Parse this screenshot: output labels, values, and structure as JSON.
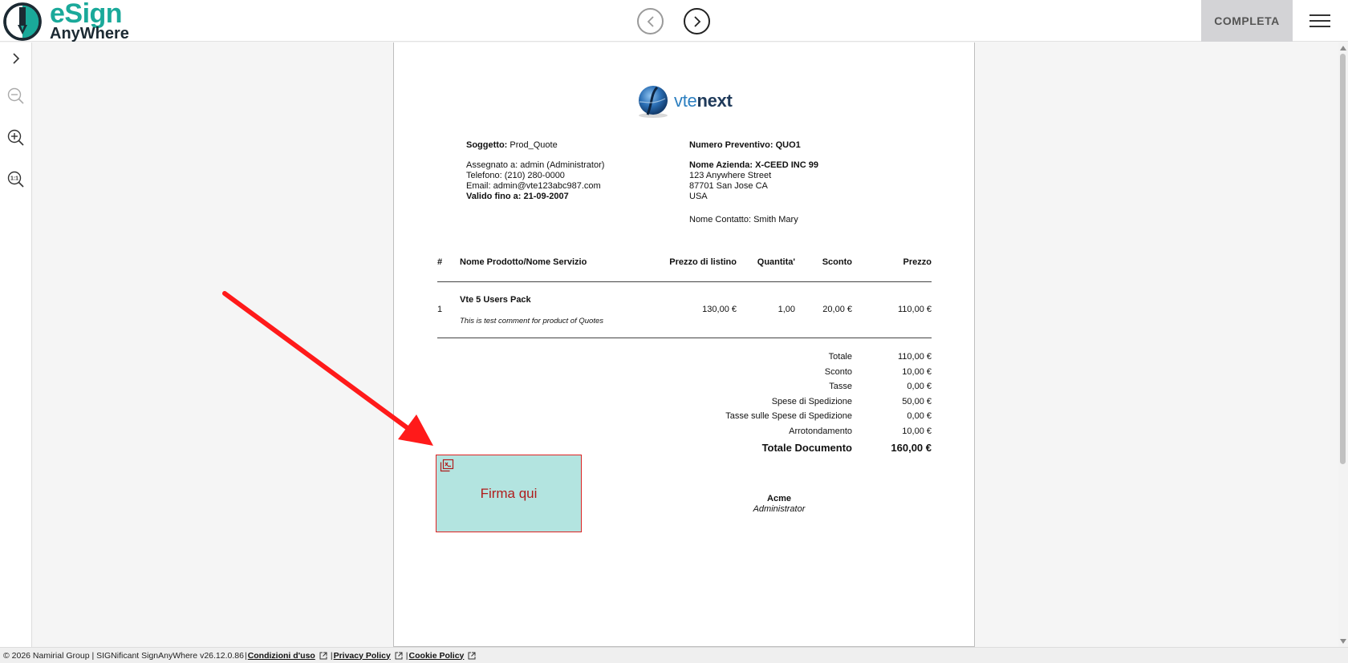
{
  "header": {
    "logo": {
      "line1": "eSign",
      "line2": "AnyWhere"
    },
    "complete_label": "COMPLETA",
    "icons": {
      "prev": "chevron-left-icon",
      "next": "chevron-right-icon",
      "menu": "hamburger-menu-icon"
    }
  },
  "toolbar": {
    "icons": [
      "chevron-right-icon",
      "zoom-out-icon",
      "zoom-in-icon",
      "zoom-reset-icon"
    ]
  },
  "document": {
    "logo_text_a": "vte",
    "logo_text_b": "next",
    "left_block": {
      "subject_label": "Soggetto:",
      "subject_value": "Prod_Quote",
      "assigned": "Assegnato a: admin (Administrator)",
      "phone": "Telefono: (210) 280-0000",
      "email": "Email: admin@vte123abc987.com",
      "valid": "Valido fino a: 21-09-2007"
    },
    "right_block": {
      "quote_number": "Numero Preventivo: QUO1",
      "company": "Nome Azienda: X-CEED INC 99",
      "street": "123 Anywhere Street",
      "city": "87701 San Jose CA",
      "country": "USA",
      "contact": "Nome Contatto: Smith Mary"
    },
    "table": {
      "headers": [
        "#",
        "Nome Prodotto/Nome Servizio",
        "Prezzo di listino",
        "Quantita'",
        "Sconto",
        "Prezzo"
      ],
      "rows": [
        {
          "num": "1",
          "name": "Vte 5 Users Pack",
          "comment": "This is test comment for product of Quotes",
          "list_price": "130,00 €",
          "qty": "1,00",
          "discount": "20,00 €",
          "price": "110,00 €"
        }
      ]
    },
    "totals": [
      {
        "label": "Totale",
        "value": "110,00 €"
      },
      {
        "label": "Sconto",
        "value": "10,00 €"
      },
      {
        "label": "Tasse",
        "value": "0,00 €"
      },
      {
        "label": "Spese di Spedizione",
        "value": "50,00 €"
      },
      {
        "label": "Tasse sulle Spese di Spedizione",
        "value": "0,00 €"
      },
      {
        "label": "Arrotondamento",
        "value": "10,00 €"
      }
    ],
    "grand_total": {
      "label": "Totale Documento",
      "value": "160,00 €"
    },
    "signature": {
      "label": "Firma qui",
      "icon": "signature-field-icon"
    },
    "signer": {
      "name": "Acme",
      "role": "Administrator"
    }
  },
  "footer": {
    "copyright": "© 2026 Namirial Group | SIGNificant SignAnyWhere v26.12.0.86",
    "links": [
      "Condizioni d'uso",
      "Privacy Policy",
      "Cookie Policy"
    ],
    "icon": "external-link-icon"
  },
  "colors": {
    "brand": "#1aa99a",
    "sign_field_bg": "#b3e4e0",
    "sign_field_text": "#b01c1c",
    "arrow": "#ff1a1a"
  }
}
